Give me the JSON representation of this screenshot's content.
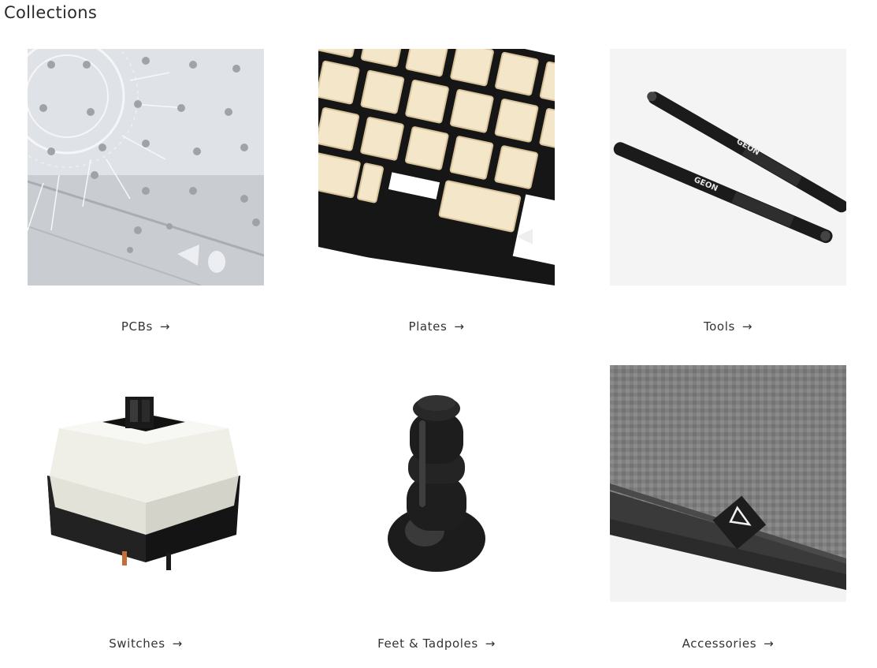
{
  "page": {
    "title": "Collections"
  },
  "collections": [
    {
      "label": "PCBs",
      "arrow": "→",
      "icon": "pcb-plate-image"
    },
    {
      "label": "Plates",
      "arrow": "→",
      "icon": "keyboard-plate-image"
    },
    {
      "label": "Tools",
      "arrow": "→",
      "icon": "switch-tools-image"
    },
    {
      "label": "Switches",
      "arrow": "→",
      "icon": "mechanical-switch-image"
    },
    {
      "label": "Feet & Tadpoles",
      "arrow": "→",
      "icon": "rubber-foot-image"
    },
    {
      "label": "Accessories",
      "arrow": "→",
      "icon": "microfiber-cloth-image"
    }
  ],
  "image_text": {
    "tools_brand": "GEON"
  },
  "colors": {
    "text": "#2a2a2a",
    "pcb_silver": "#d8dbe0",
    "plate_black": "#161616",
    "plate_cream": "#f1e3c6",
    "cloth_gray": "#7d7d7d"
  }
}
